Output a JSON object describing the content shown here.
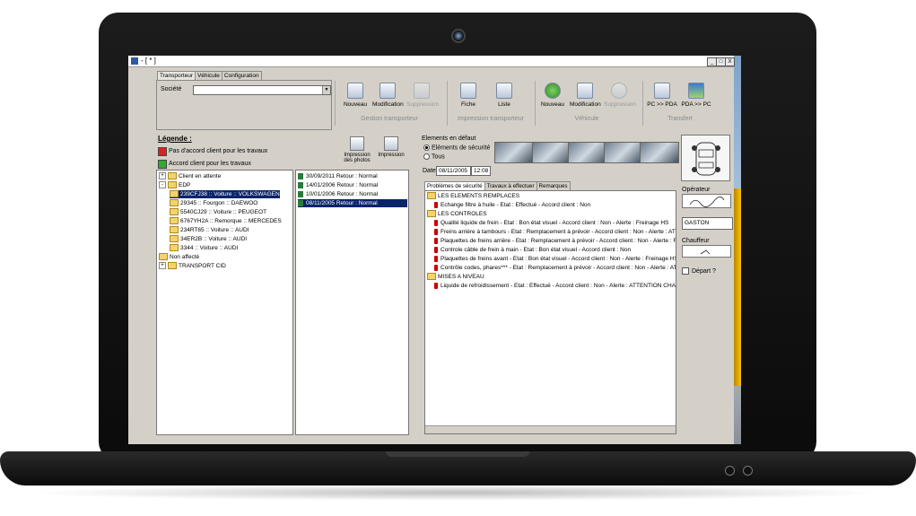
{
  "window": {
    "title": "- [ * ]",
    "controls": [
      "_",
      "□",
      "X"
    ]
  },
  "tabs": [
    "Transporteur",
    "Véhicule",
    "Configuration"
  ],
  "societe_label": "Société",
  "toolbar": {
    "gestion": {
      "label": "Gestion transporteur",
      "buttons": [
        "Nouveau",
        "Modification",
        "Suppression"
      ]
    },
    "impression": {
      "label": "Impression transporteur",
      "buttons": [
        "Fiche",
        "Liste"
      ]
    },
    "vehicule": {
      "label": "Véhicule",
      "buttons": [
        "Nouveau",
        "Modification",
        "Suppression"
      ]
    },
    "transfert": {
      "label": "Transfert",
      "buttons": [
        "PC >> PDA",
        "PDA >> PC"
      ]
    }
  },
  "legend": {
    "title": "Légende :",
    "red": "Pas d'accord client pour les travaux",
    "green": "Accord client pour les travaux",
    "btn_photos": "Impression des photos",
    "btn_impression": "Impression"
  },
  "tree": [
    {
      "text": "Client en attente",
      "level": 0,
      "expander": "+"
    },
    {
      "text": "EDP",
      "level": 0,
      "expander": "-"
    },
    {
      "text": "239CFJ38 :: Voiture :: VOLKSWAGEN",
      "level": 1,
      "selected": true
    },
    {
      "text": "29345 :: Fourgon :: DAEWOO",
      "level": 1
    },
    {
      "text": "5540CJ29 :: Voiture :: PEUGEOT",
      "level": 1
    },
    {
      "text": "6767YH2A :: Remorque :: MERCEDES",
      "level": 1
    },
    {
      "text": "234RT65 :: Voiture :: AUDI",
      "level": 1
    },
    {
      "text": "34ER2B :: Voiture :: AUDI",
      "level": 1
    },
    {
      "text": "3344 :: Voiture :: AUDI",
      "level": 1
    },
    {
      "text": "Non affecté",
      "level": 0
    },
    {
      "text": "TRANSPORT CID",
      "level": 0,
      "expander": "+"
    }
  ],
  "history": [
    {
      "text": "30/09/2011 Retour : Normal"
    },
    {
      "text": "14/01/2006 Retour : Normal"
    },
    {
      "text": "10/01/2006 Retour : Normal"
    },
    {
      "text": "08/11/2005 Retour : Normal",
      "selected": true
    }
  ],
  "defaults": {
    "title": "Elements en défaut",
    "opt_security": "Eléments de sécurité",
    "opt_all": "Tous",
    "date_label": "Date",
    "date_value": "08/11/2005",
    "time_value": "12:08"
  },
  "subtabs": [
    "Problèmes de sécurité",
    "Travaux à effectuer",
    "Remarques"
  ],
  "problems": [
    {
      "text": "LES ELEMENTS REMPLACES",
      "type": "group"
    },
    {
      "text": "Echange filtre à huile - Etat : Effectué - Accord client : Non",
      "type": "item"
    },
    {
      "text": "LES CONTROLES",
      "type": "group"
    },
    {
      "text": "Qualité liquide de frein - Etat : Bon état visuel - Accord client : Non - Alerte : Freinage HS",
      "type": "item"
    },
    {
      "text": "Freins arrière à tambours - Etat : Remplacement à prévoir - Accord client : Non - Alerte : ATTENTION",
      "type": "item"
    },
    {
      "text": "Plaquettes de freins arrière - Etat : Remplacement à prévoir - Accord client : Non - Alerte : Freinage",
      "type": "item"
    },
    {
      "text": "Controle câble de frein à main - Etat : Bon état visuel - Accord client : Non",
      "type": "item"
    },
    {
      "text": "Plaquettes de freins avant - Etat : Bon état visuel - Accord client : Non - Alerte : Freinage HS",
      "type": "item"
    },
    {
      "text": "Contrôle codes, phares*** - Etat : Remplacement à prévoir - Accord client : Non - Alerte : ATTENTI",
      "type": "item"
    },
    {
      "text": "MISES A NIVEAU",
      "type": "group"
    },
    {
      "text": "Liquide de refroidissement - Etat : Effectué - Accord client : Non - Alerte : ATTENTION CHANGEMI",
      "type": "item"
    }
  ],
  "side": {
    "operateur_label": "Opérateur",
    "operateur_name": "GASTON",
    "chauffeur_label": "Chauffeur",
    "depart_label": "Départ ?"
  }
}
